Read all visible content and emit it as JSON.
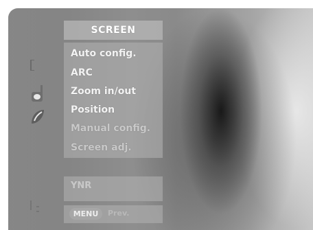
{
  "menu": {
    "title": "SCREEN",
    "items": [
      {
        "label": "Auto config."
      },
      {
        "label": "ARC"
      },
      {
        "label": "Zoom in/out"
      },
      {
        "label": "Position"
      },
      {
        "label": "Manual config."
      },
      {
        "label": "Screen adj."
      }
    ],
    "extra_item": {
      "label": "YNR"
    },
    "footer": {
      "key_label": "MENU",
      "action_label": "Prev."
    }
  },
  "side_icons": [
    "bracket-icon",
    "screen-icon",
    "leaf-icon",
    "dotted-bracket-icon"
  ]
}
